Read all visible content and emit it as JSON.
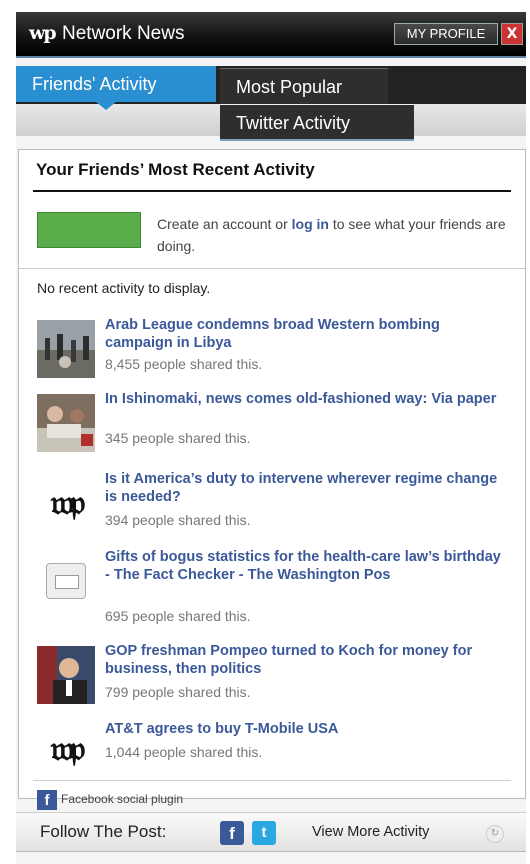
{
  "header": {
    "logo_text": "wp",
    "title": "Network News",
    "profile_label": "MY PROFILE",
    "close_label": "X"
  },
  "tabs": [
    {
      "label": "Friends' Activity",
      "active": true
    },
    {
      "label": "Most Popular",
      "active": false
    },
    {
      "label": "Twitter Activity",
      "active": false
    }
  ],
  "panel": {
    "title": "Your Friends’ Most Recent Activity",
    "login_prefix": "Create an account or ",
    "login_link": "log in",
    "login_suffix": " to see what your friends are doing.",
    "no_activity": "No recent activity to display.",
    "items": [
      {
        "title": "Arab League condemns broad Western bombing campaign in Libya",
        "shares": "8,455 people shared this.",
        "thumb": "photo-crowd"
      },
      {
        "title": "In Ishinomaki, news comes old-fashioned way: Via paper",
        "shares": "345 people shared this.",
        "thumb": "photo-reading"
      },
      {
        "title": "Is it America’s duty to intervene wherever regime change is needed?",
        "shares": "394 people shared this.",
        "thumb": "wp-logo"
      },
      {
        "title": "Gifts of bogus statistics for the health-care law’s birthday - The Fact Checker - The Washington Pos",
        "shares": "695 people shared this.",
        "thumb": "email-icon"
      },
      {
        "title": "GOP freshman Pompeo turned to Koch for money for business, then politics",
        "shares": "799 people shared this.",
        "thumb": "photo-portrait"
      },
      {
        "title": "AT&T agrees to buy T-Mobile USA",
        "shares": "1,044 people shared this.",
        "thumb": "wp-logo"
      }
    ],
    "plugin_label": "Facebook social plugin"
  },
  "footer": {
    "follow_label": "Follow The Post:",
    "view_more": "View More Activity"
  },
  "colors": {
    "tab_active": "#2a8fd0",
    "link": "#3b5998",
    "fb_green": "#5aad4a"
  }
}
